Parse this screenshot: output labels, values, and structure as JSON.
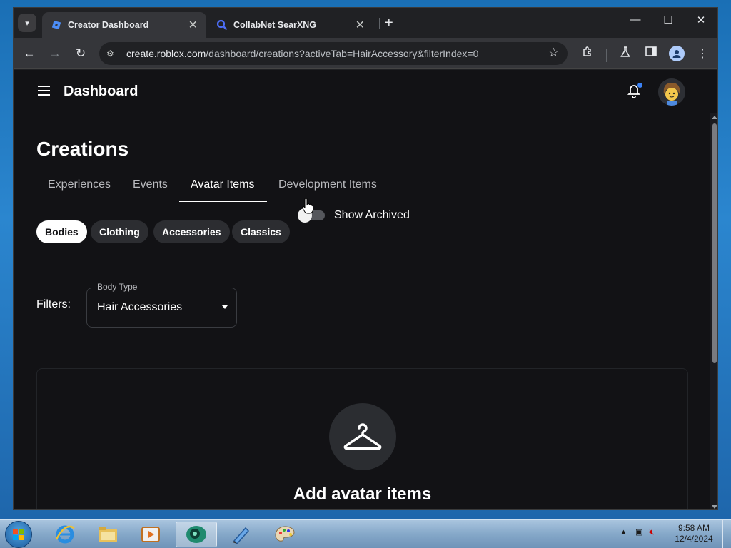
{
  "browser": {
    "tabs": [
      {
        "title": "Creator Dashboard",
        "favicon": "roblox-icon",
        "active": true,
        "close": "✕"
      },
      {
        "title": "CollabNet SearXNG",
        "favicon": "search-icon",
        "active": false,
        "close": "✕"
      }
    ],
    "new_tab": "+",
    "address": {
      "host": "create.roblox.com",
      "path": "/dashboard/creations?activeTab=HairAccessory&filterIndex=0"
    }
  },
  "app": {
    "title": "Dashboard",
    "notification_dot_color": "#3b82f6"
  },
  "page": {
    "heading": "Creations",
    "tabs": [
      {
        "label": "Experiences",
        "selected": false
      },
      {
        "label": "Events",
        "selected": false
      },
      {
        "label": "Avatar Items",
        "selected": true
      },
      {
        "label": "Development Items",
        "selected": false
      }
    ],
    "chips": [
      {
        "label": "Bodies",
        "selected": true
      },
      {
        "label": "Clothing",
        "selected": false
      },
      {
        "label": "Accessories",
        "selected": false
      },
      {
        "label": "Classics",
        "selected": false
      }
    ],
    "show_archived": {
      "label": "Show Archived",
      "on": false
    },
    "filters": {
      "label": "Filters:",
      "select_legend": "Body Type",
      "select_value": "Hair Accessories"
    },
    "empty_state": {
      "title": "Add avatar items",
      "icon": "hanger-icon"
    }
  },
  "taskbar": {
    "clock_time": "9:58 AM",
    "clock_date": "12/4/2024"
  }
}
